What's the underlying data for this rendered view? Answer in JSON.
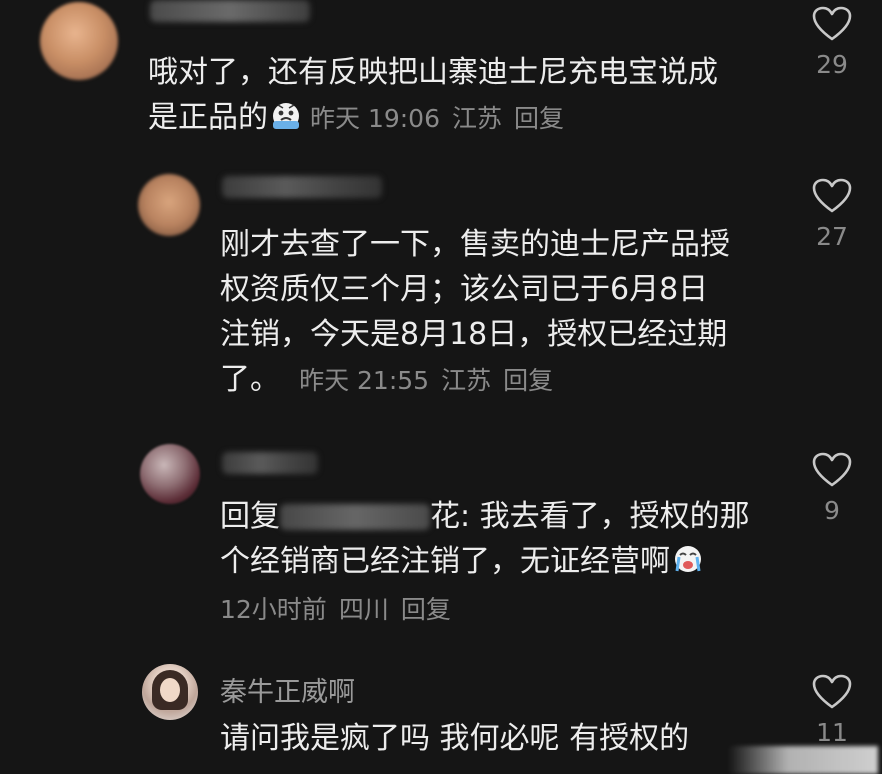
{
  "comments": [
    {
      "name": "",
      "text_lines": [
        "哦对了，还有反映把山寨迪士尼充电宝说成",
        "是正品的"
      ],
      "emoji": "crying-face-emoji",
      "time": "昨天 19:06",
      "location": "江苏",
      "reply": "回复",
      "likes": "29"
    },
    {
      "name": "",
      "text_lines": [
        "刚才去查了一下，售卖的迪士尼产品授",
        "权资质仅三个月；该公司已于6月8日",
        "注销，今天是8月18日，授权已经过期",
        "了。"
      ],
      "time": "昨天 21:55",
      "location": "江苏",
      "reply": "回复",
      "likes": "27"
    },
    {
      "name": "",
      "reply_prefix": "回复",
      "reply_target_suffix": "花:",
      "text_lines": [
        "我去看了，授权的那",
        "个经销商已经注销了，无证经营啊"
      ],
      "emoji": "loudly-crying-emoji",
      "time": "12小时前",
      "location": "四川",
      "reply": "回复",
      "likes": "9"
    },
    {
      "name": "秦牛正威啊",
      "text_lines": [
        "请问我是疯了吗 我何必呢 有授权的"
      ],
      "likes": "11"
    }
  ],
  "colors": {
    "background": "#151515",
    "text": "#ededed",
    "meta": "#8a8a8a"
  }
}
